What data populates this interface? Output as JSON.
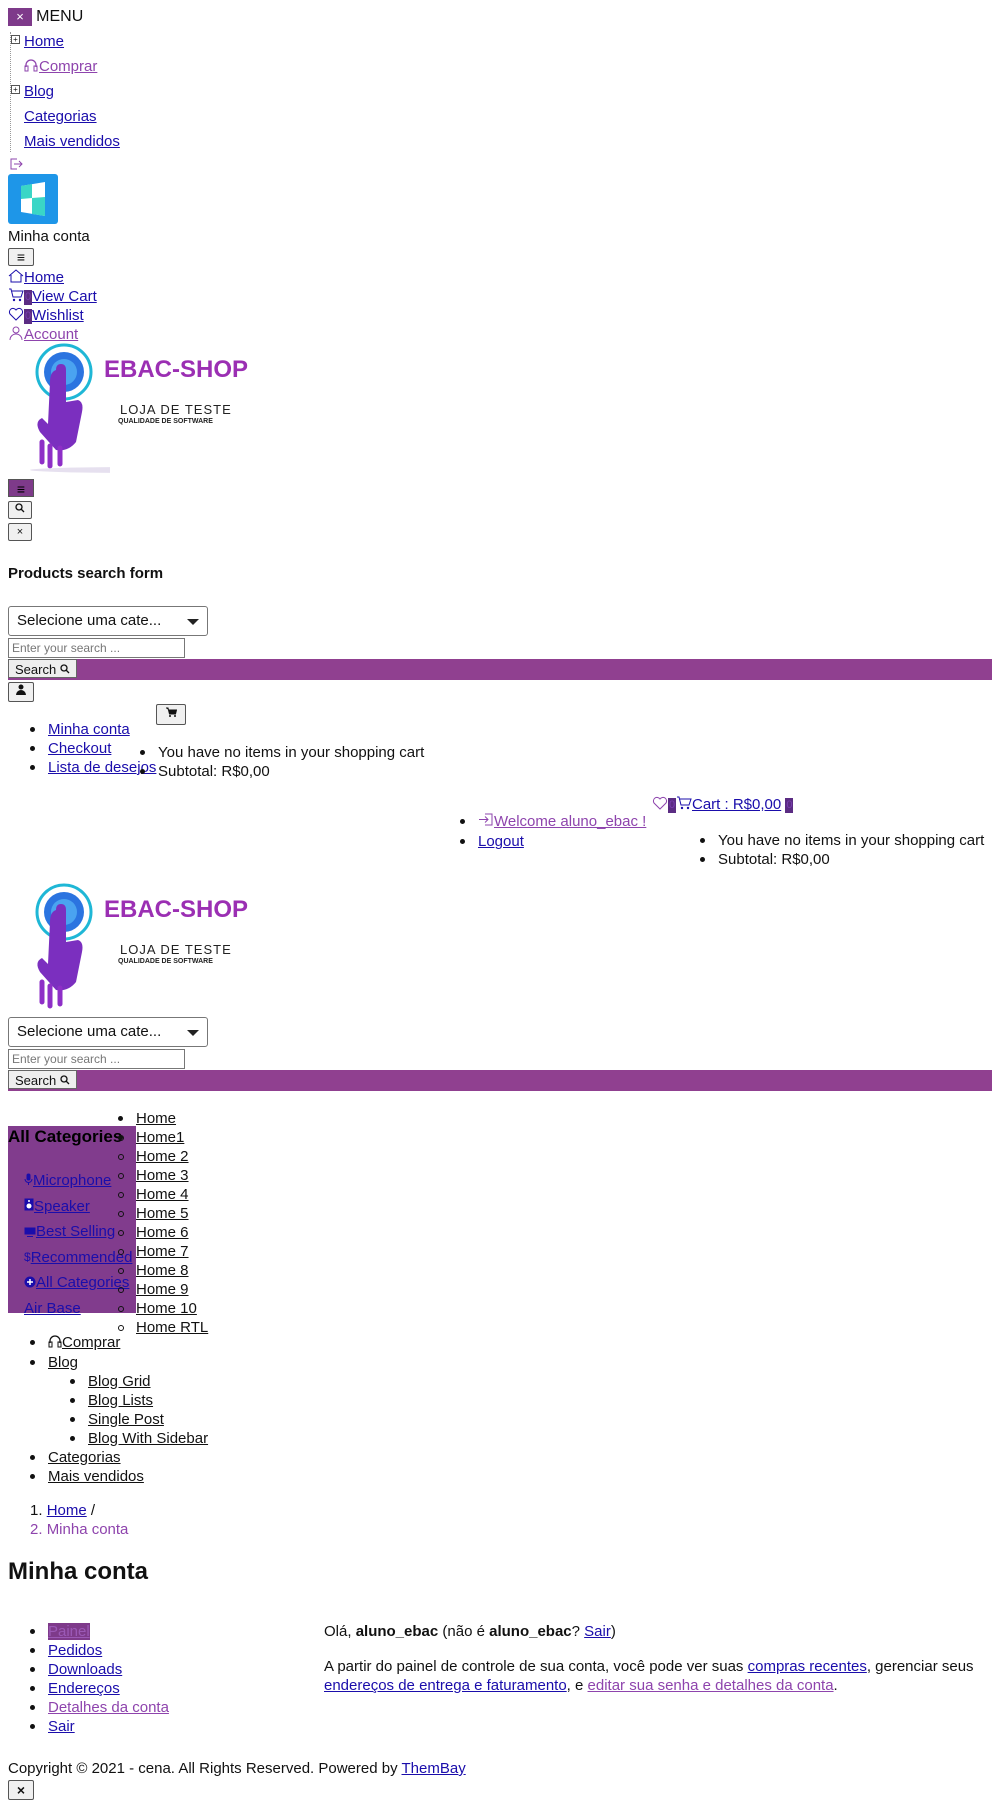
{
  "menu": {
    "close": "×",
    "label": "MENU",
    "items": [
      "Home",
      "Comprar",
      "Blog",
      "Categorias",
      "Mais vendidos"
    ]
  },
  "account_panel": {
    "title": "Minha conta",
    "toggle": "≡"
  },
  "quick_links": [
    {
      "label": "Home",
      "badge": ""
    },
    {
      "label": "View Cart",
      "badge": "0"
    },
    {
      "label": "Wishlist",
      "badge": "0"
    },
    {
      "label": "Account",
      "badge": ""
    }
  ],
  "logo": {
    "name": "EBAC-SHOP",
    "tagline": "LOJA DE TESTE",
    "subtagline": "QUALIDADE DE SOFTWARE"
  },
  "header_buttons": {
    "menu": "≡",
    "close": "×"
  },
  "search": {
    "title": "Products search form",
    "category_select": "Selecione uma cate...",
    "placeholder": "Enter your search ...",
    "button": "Search"
  },
  "user_menu": [
    "Minha conta",
    "Checkout",
    "Lista de desejos"
  ],
  "mini_cart": {
    "empty": "You have no items in your shopping cart",
    "subtotal": "Subtotal: R$0,00"
  },
  "top_bar": {
    "wishlist_count": "0",
    "cart_label": "Cart : R$0,00",
    "cart_count": "0",
    "welcome": "Welcome aluno_ebac !",
    "logout": "Logout"
  },
  "categories": {
    "title": "All Categories",
    "items": [
      "Microphone",
      "Speaker",
      "Best Selling",
      "Recommended",
      "All Categories",
      "Air Base"
    ]
  },
  "home_submenu": [
    "Home",
    "Home1",
    "Home 2",
    "Home 3",
    "Home 4",
    "Home 5",
    "Home 6",
    "Home 7",
    "Home 8",
    "Home 9",
    "Home 10",
    "Home RTL"
  ],
  "main_nav": {
    "comprar": "Comprar",
    "blog": "Blog",
    "blog_items": [
      "Blog Grid",
      "Blog Lists",
      "Single Post",
      "Blog With Sidebar"
    ],
    "categorias": "Categorias",
    "mais_vendidos": "Mais vendidos"
  },
  "breadcrumb": {
    "home": "Home",
    "sep": "/",
    "current": "Minha conta"
  },
  "page_title": "Minha conta",
  "account_nav": [
    "Painel",
    "Pedidos",
    "Downloads",
    "Endereços",
    "Detalhes da conta",
    "Sair"
  ],
  "dashboard": {
    "hello_prefix": "Olá,",
    "user": "aluno_ebac",
    "not_prefix": "(não é",
    "not_user": "aluno_ebac",
    "question": "?",
    "sair": "Sair",
    "close_paren": ")",
    "p_prefix": "A partir do painel de controle de sua conta, você pode ver suas",
    "link_orders": "compras recentes",
    "p_mid": ", gerenciar seus",
    "link_addresses": "endereços de entrega e faturamento",
    "p_mid2": ", e",
    "link_account": "editar sua senha e detalhes da conta",
    "p_end": "."
  },
  "footer": {
    "copyright": "Copyright © 2021 - cena. All Rights Reserved. Powered by",
    "powered_link": "ThemBay",
    "close": "×"
  },
  "colors": {
    "brand_purple": "#904090",
    "link_blue": "#1a0dab",
    "link_purple": "#8e44ad"
  }
}
